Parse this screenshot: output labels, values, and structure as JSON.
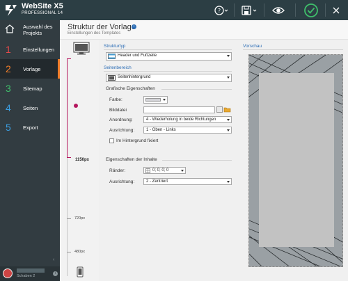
{
  "app": {
    "title": "WebSite X5",
    "edition": "PROFESSIONAL 14"
  },
  "toolbar": {
    "help_icon": "question-circle-icon",
    "save_icon": "floppy-disk-icon",
    "preview_icon": "eye-icon",
    "publish_icon": "check-circle-icon"
  },
  "sidebar": {
    "home_label": "Auswahl des Projekts",
    "items": [
      {
        "num": "1",
        "label": "Einstellungen",
        "color": "#e64a4a"
      },
      {
        "num": "2",
        "label": "Vorlage",
        "color": "#f07d2a"
      },
      {
        "num": "3",
        "label": "Sitemap",
        "color": "#3fbf6b"
      },
      {
        "num": "4",
        "label": "Seiten",
        "color": "#3b9ee0"
      },
      {
        "num": "5",
        "label": "Export",
        "color": "#3b9ee0"
      }
    ],
    "user_label": "Schaben 2"
  },
  "page": {
    "title": "Struktur der Vorlage",
    "subtitle": "Einstellungen des Templates"
  },
  "ruler": {
    "labels": [
      "1150px",
      "720px",
      "480px"
    ]
  },
  "form": {
    "strukturtyp_label": "Strukturtyp",
    "strukturtyp_value": "Header und Fußzeile",
    "seitenbereich_label": "Seitenbereich",
    "seitenbereich_value": "Seitenhintergrund",
    "grafische_label": "Grafische Eigenschaften",
    "farbe_label": "Farbe:",
    "bilddatei_label": "Bilddatei",
    "anordnung_label": "Anordnung:",
    "anordnung_value": "4 - Wiederholung in beide Richtungen",
    "ausrichtung_label": "Ausrichtung:",
    "ausrichtung_value": "1 - Oben - Links",
    "hintergrund_fixiert_label": "Im Hintergrund fixiert",
    "inhalte_label": "Eigenschaften der Inhalte",
    "raender_label": "Ränder:",
    "raender_value": "0; 0; 0; 0",
    "ausrichtung2_label": "Ausrichtung:",
    "ausrichtung2_value": "2 - Zentriert"
  },
  "preview": {
    "label": "Vorschau"
  },
  "colors": {
    "topbar": "#2c3e44",
    "sidebar": "#323c41",
    "accent_red": "#b5175e",
    "link_blue": "#2c6db5",
    "publish_green": "#3fbf6b"
  }
}
